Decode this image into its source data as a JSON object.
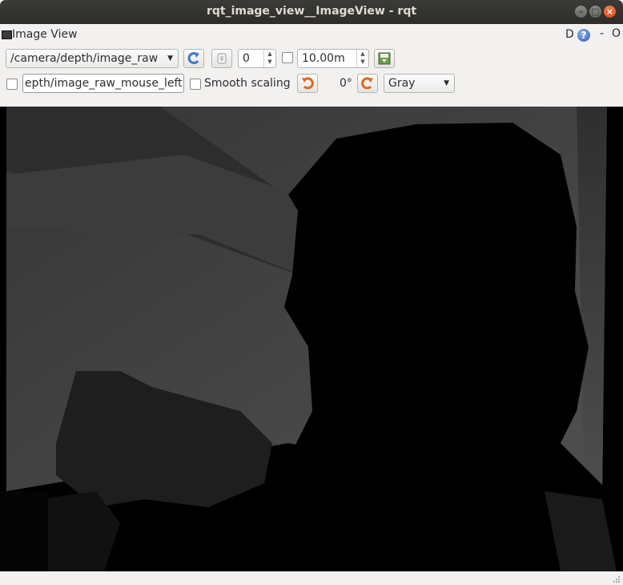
{
  "window": {
    "title": "rqt_image_view__ImageView - rqt"
  },
  "plugin": {
    "title": "Image View",
    "d_label": "D",
    "help": "?",
    "minimize": "-",
    "close": "O"
  },
  "toolbar": {
    "topic": "/camera/depth/image_raw",
    "number_value": "0",
    "max_range": "10.00m",
    "mouse_topic": "epth/image_raw_mouse_left",
    "smooth_scaling_label": "Smooth scaling",
    "smooth_scaling_checked": false,
    "rotation": "0°",
    "colormap": "Gray"
  },
  "icons": {
    "refresh": "refresh-icon",
    "pause": "pause-icon",
    "save": "save-icon",
    "rotate_left": "rotate-left-icon",
    "rotate_right": "rotate-right-icon"
  },
  "image": {
    "description_colors": {
      "far": "#4a4a4a",
      "mid": "#2a2a2a",
      "near": "#000000"
    }
  }
}
